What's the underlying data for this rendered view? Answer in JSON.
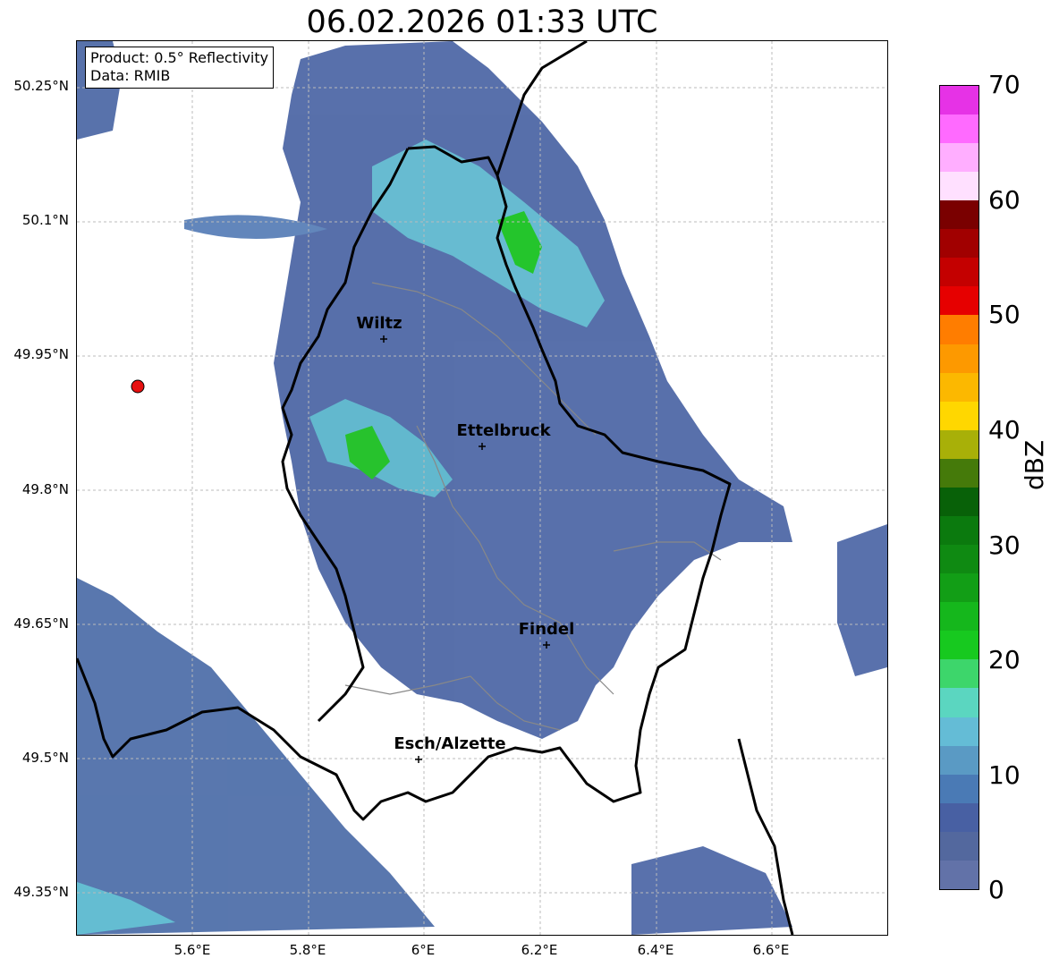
{
  "title": "06.02.2026 01:33 UTC",
  "info": {
    "product": "Product: 0.5° Reflectivity",
    "data": "Data: RMIB"
  },
  "lat_labels": [
    "50.25°N",
    "50.1°N",
    "49.95°N",
    "49.8°N",
    "49.65°N",
    "49.5°N",
    "49.35°N"
  ],
  "lon_labels": [
    "5.6°E",
    "5.8°E",
    "6°E",
    "6.2°E",
    "6.4°E",
    "6.6°E"
  ],
  "cities": [
    {
      "name": "Wiltz"
    },
    {
      "name": "Ettelbruck"
    },
    {
      "name": "Findel"
    },
    {
      "name": "Esch/Alzette"
    }
  ],
  "colorbar": {
    "unit": "dBZ",
    "ticks": [
      "0",
      "10",
      "20",
      "30",
      "40",
      "50",
      "60",
      "70"
    ],
    "colors": [
      "#6272a8",
      "#53689e",
      "#4860a3",
      "#4a7ab5",
      "#5a9ac4",
      "#64bcd6",
      "#5bd6c0",
      "#3dd66b",
      "#17c91f",
      "#15b71c",
      "#129e16",
      "#0f8a12",
      "#0b7a0e",
      "#086108",
      "#457a0a",
      "#a8b008",
      "#ffd700",
      "#fcb800",
      "#fd9900",
      "#ff7d00",
      "#e60000",
      "#c40000",
      "#a10000",
      "#7a0000",
      "#ffe0ff",
      "#ffaeff",
      "#ff6aff",
      "#e632e6"
    ]
  },
  "colors": {
    "border": "#000000",
    "admin": "#888888",
    "grid": "#bbbbbb",
    "radar_site": "#e61010"
  }
}
